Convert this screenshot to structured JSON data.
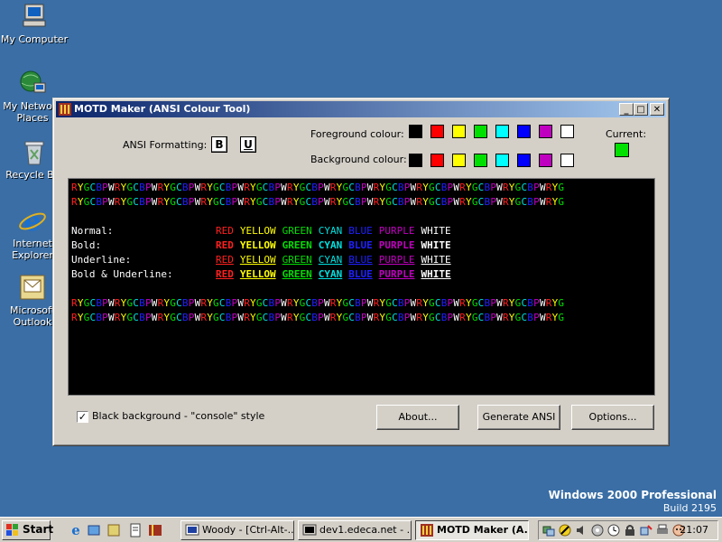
{
  "desktop": {
    "icons": [
      {
        "name": "my-computer",
        "label": "My Computer"
      },
      {
        "name": "my-network-places",
        "label": "My Network Places"
      },
      {
        "name": "recycle-bin",
        "label": "Recycle Bin"
      },
      {
        "name": "internet-explorer",
        "label": "Internet Explorer"
      },
      {
        "name": "microsoft-outlook",
        "label": "Microsoft Outlook"
      }
    ],
    "watermark_line1": "Windows 2000 Professional",
    "watermark_line2": "Build 2195",
    "background_color": "#3a6ea5"
  },
  "window": {
    "title": "MOTD Maker (ANSI Colour Tool)",
    "ansi_formatting_label": "ANSI Formatting:",
    "bold_button": "B",
    "underline_button": "U",
    "foreground_label": "Foreground colour:",
    "background_label": "Background colour:",
    "current_label": "Current:",
    "current_color": "#00e000",
    "palette": [
      "#000000",
      "#ff0000",
      "#ffff00",
      "#00e000",
      "#00ffff",
      "#0000ff",
      "#c000c0",
      "#ffffff"
    ],
    "preview": {
      "stripe_text": "RYGCBPWRYGCBPWRYGCBPWRYGCBPWRYGCBPWRYGCBPWRYGCBPWRYGCBPWRYGCBPWRYGCBPWRYGCBPWRYG",
      "stripe_text_offset": "RYGCBPWRYGCBPWRYGCBPWRYGCBPWRYGCBPWRYGCBPWRYGCBPWRYGCBPWRYGCBPWRYGCBPWRYGCBPWRYG",
      "color_map": {
        "R": "#ff2020",
        "Y": "#ffff00",
        "G": "#00e000",
        "C": "#00e0e0",
        "B": "#2020ff",
        "P": "#c000c0",
        "W": "#ffffff"
      },
      "rows": [
        {
          "label": "Normal:",
          "style": "normal"
        },
        {
          "label": "Bold:",
          "style": "bold"
        },
        {
          "label": "Underline:",
          "style": "underline"
        },
        {
          "label": "Bold & Underline:",
          "style": "bold-underline"
        }
      ],
      "color_words": [
        {
          "text": "RED",
          "color": "#ff2020"
        },
        {
          "text": "YELLOW",
          "color": "#ffff00"
        },
        {
          "text": "GREEN",
          "color": "#00e000"
        },
        {
          "text": "CYAN",
          "color": "#00e0e0"
        },
        {
          "text": "BLUE",
          "color": "#2020ff"
        },
        {
          "text": "PURPLE",
          "color": "#c000c0"
        },
        {
          "text": "WHITE",
          "color": "#ffffff"
        }
      ]
    },
    "checkbox_label": "Black background - \"console\" style",
    "checkbox_checked": true,
    "about_button": "About...",
    "generate_button": "Generate ANSI",
    "options_button": "Options..."
  },
  "taskbar": {
    "start_label": "Start",
    "tasks": [
      {
        "label": "Woody - [Ctrl-Alt-...",
        "active": false
      },
      {
        "label": "dev1.edeca.net - ...",
        "active": false
      },
      {
        "label": "MOTD Maker (A...",
        "active": true
      }
    ],
    "clock": "21:07"
  }
}
